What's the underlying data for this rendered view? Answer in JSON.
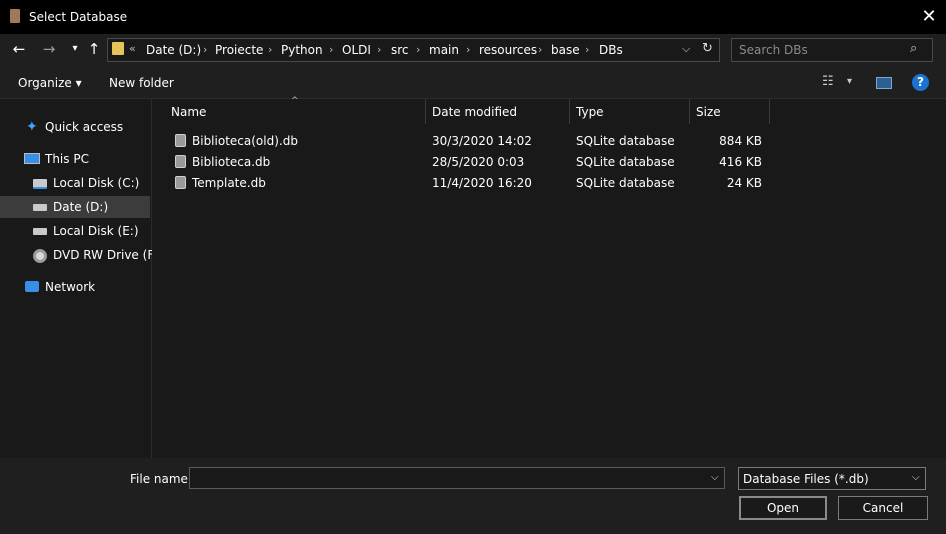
{
  "window": {
    "title": "Select Database",
    "close_glyph": "✕"
  },
  "nav": {
    "back": "←",
    "forward": "→",
    "recent": "▾",
    "up": "↑"
  },
  "address": {
    "overflow": "«",
    "crumbs": [
      "Date (D:)",
      "Proiecte",
      "Python",
      "OLDI",
      "src",
      "main",
      "resources",
      "base",
      "DBs"
    ],
    "separator": "›",
    "dropdown": "⌵",
    "refresh": "↻"
  },
  "search": {
    "placeholder": "Search DBs",
    "icon": "⌕"
  },
  "toolbar": {
    "organize": "Organize ▾",
    "new_folder": "New folder",
    "view_icon": "☷",
    "view_dd": "▾",
    "help": "?"
  },
  "sidebar": {
    "items": [
      {
        "label": "Quick access",
        "icon": "star-icon"
      },
      {
        "label": "This PC",
        "icon": "monitor-icon"
      },
      {
        "label": "Local Disk (C:)",
        "icon": "drive-icon"
      },
      {
        "label": "Date (D:)",
        "icon": "drive-icon",
        "selected": true
      },
      {
        "label": "Local Disk (E:)",
        "icon": "drive-icon"
      },
      {
        "label": "DVD RW Drive (F:)",
        "icon": "disc-icon"
      },
      {
        "label": "Network",
        "icon": "network-icon"
      }
    ]
  },
  "columns": {
    "name": "Name",
    "date": "Date modified",
    "type": "Type",
    "size": "Size"
  },
  "files": [
    {
      "name": "Biblioteca(old).db",
      "date": "30/3/2020 14:02",
      "type": "SQLite database",
      "size": "884 KB"
    },
    {
      "name": "Biblioteca.db",
      "date": "28/5/2020 0:03",
      "type": "SQLite database",
      "size": "416 KB"
    },
    {
      "name": "Template.db",
      "date": "11/4/2020 16:20",
      "type": "SQLite database",
      "size": "24 KB"
    }
  ],
  "bottom": {
    "file_name_label": "File name:",
    "file_name_value": "",
    "file_filter": "Database Files (*.db)",
    "dd_glyph": "⌵",
    "open_label": "Open",
    "cancel_label": "Cancel"
  },
  "colors": {
    "background": "#191919",
    "selected": "#3c3c3c",
    "help": "#1a73d1"
  }
}
